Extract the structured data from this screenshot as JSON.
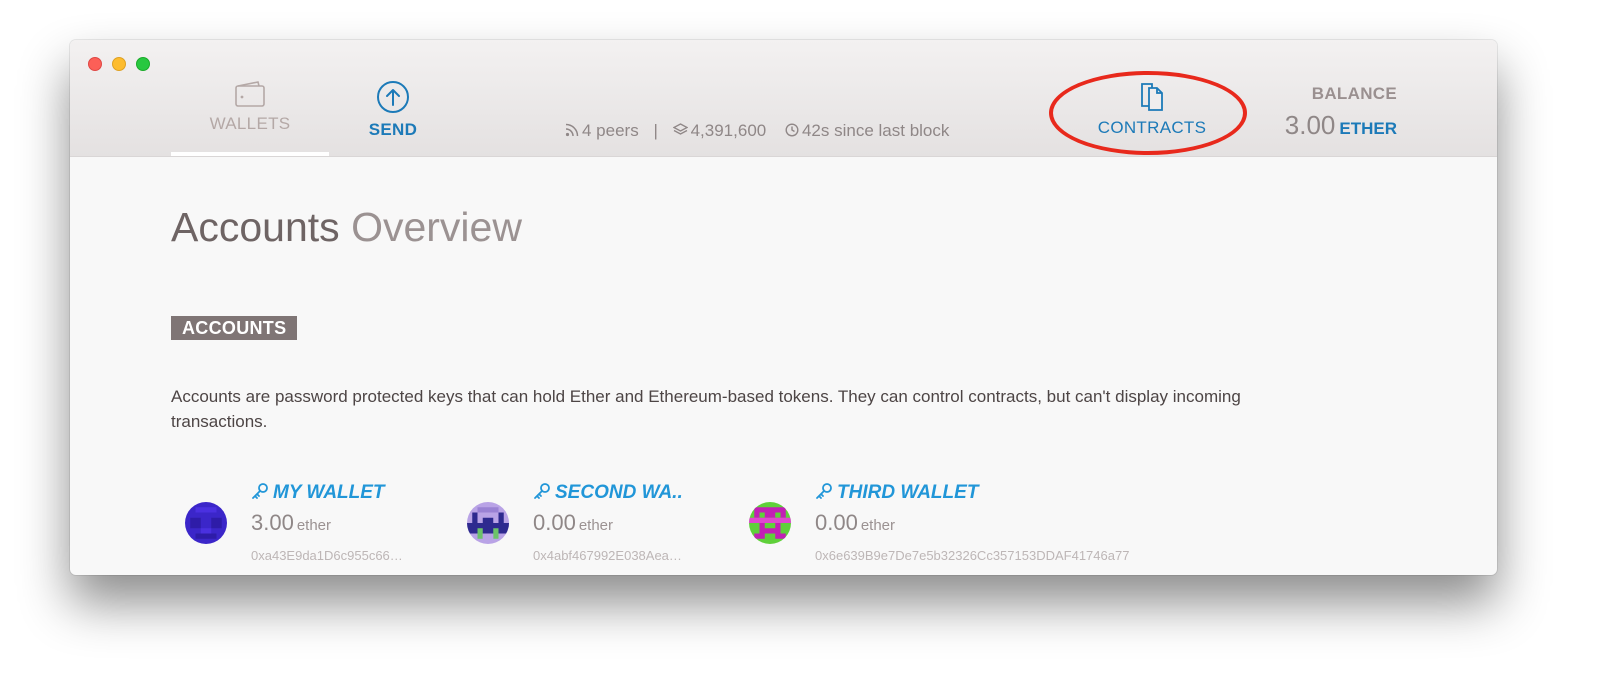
{
  "window": {
    "traffic_lights": [
      "close",
      "minimize",
      "zoom"
    ]
  },
  "nav": {
    "wallets": {
      "label": "WALLETS",
      "icon": "wallet-icon"
    },
    "send": {
      "label": "SEND",
      "icon": "arrow-up-circle-icon"
    },
    "contracts": {
      "label": "CONTRACTS",
      "icon": "documents-icon"
    }
  },
  "status": {
    "peers": "4 peers",
    "block": "4,391,600",
    "since": "42s since last block",
    "separator": "|"
  },
  "balance": {
    "title": "BALANCE",
    "amount": "3.00",
    "unit": "ETHER"
  },
  "page": {
    "title_strong": "Accounts",
    "title_light": "Overview",
    "section_label": "ACCOUNTS",
    "description": "Accounts are password protected keys that can hold Ether and Ethereum-based tokens. They can control contracts, but can't display incoming transactions."
  },
  "accounts": [
    {
      "name": "MY WALLET",
      "balance": "3.00",
      "unit": "ether",
      "address": "0xa43E9da1D6c955c66…"
    },
    {
      "name": "SECOND WA..",
      "balance": "0.00",
      "unit": "ether",
      "address": "0x4abf467992E038Aea…"
    },
    {
      "name": "THIRD WALLET",
      "balance": "0.00",
      "unit": "ether",
      "address": "0x6e639B9e7De7e5b32326Cc357153DDAF41746a77"
    }
  ],
  "colors": {
    "accent": "#1c7ab8",
    "account_name": "#2196d8",
    "highlight": "#e8291c",
    "section_badge": "#7f7575"
  }
}
